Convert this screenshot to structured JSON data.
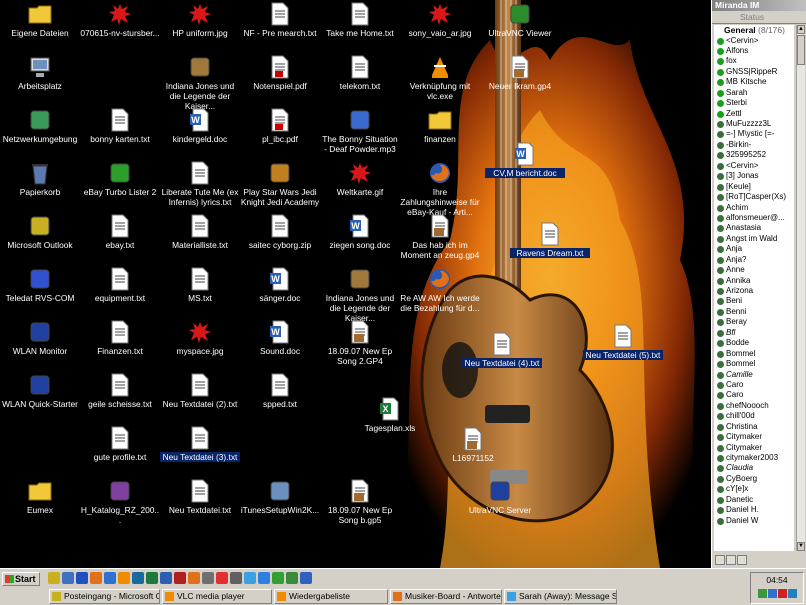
{
  "desktop": {
    "icons": [
      {
        "label": "Eigene Dateien",
        "icon": "folder-icon",
        "color": "#f0c838"
      },
      {
        "label": "070615-nv-stursber...",
        "icon": "red-splat-icon",
        "color": "#d81818"
      },
      {
        "label": "HP uniform.jpg",
        "icon": "red-splat-icon",
        "color": "#d81818"
      },
      {
        "label": "NF - Pre mearch.txt",
        "icon": "text-file-icon",
        "color": "#ffffff"
      },
      {
        "label": "Take me Home.txt",
        "icon": "text-file-icon",
        "color": "#ffffff"
      },
      {
        "label": "sony_vaio_ar.jpg",
        "icon": "red-splat-icon",
        "color": "#d81818"
      },
      {
        "label": "UltraVNC Viewer",
        "icon": "vnc-viewer-icon",
        "color": "#2a8c2a"
      },
      {
        "label": "Arbeitsplatz",
        "icon": "computer-icon",
        "color": "#7090c0"
      },
      {
        "label": "Indiana Jones und die Legende der Kaiser...",
        "icon": "game-icon",
        "color": "#a0783c"
      },
      {
        "label": "Notenspiel.pdf",
        "icon": "pdf-icon",
        "color": "#ffffff"
      },
      {
        "label": "telekom.txt",
        "icon": "text-file-icon",
        "color": "#ffffff"
      },
      {
        "label": "Verknüpfung mit vlc.exe",
        "icon": "vlc-icon",
        "color": "#f08c00"
      },
      {
        "label": "Neuer Ikram.gp4",
        "icon": "media-file-icon",
        "color": "#ffffff"
      },
      {
        "label": "Netzwerkumgebung",
        "icon": "network-icon",
        "color": "#3a9a5a"
      },
      {
        "label": "bonny karten.txt",
        "icon": "text-file-icon",
        "color": "#ffffff"
      },
      {
        "label": "kindergeld.doc",
        "icon": "word-doc-icon",
        "color": "#2b5fb4"
      },
      {
        "label": "pl_ibc.pdf",
        "icon": "pdf-icon",
        "color": "#ffffff"
      },
      {
        "label": "The Bonny Situation - Deaf Powder.mp3",
        "icon": "mp3-icon",
        "color": "#3a6ad0"
      },
      {
        "label": "finanzen",
        "icon": "folder-icon",
        "color": "#f0c838"
      },
      {
        "label": "CV,M bericht.doc",
        "icon": "word-doc-icon",
        "color": "#2b5fb4"
      },
      {
        "label": "Papierkorb",
        "icon": "recycle-bin-icon",
        "color": "#5a7ab0"
      },
      {
        "label": "eBay Turbo Lister 2",
        "icon": "ebay-lister-icon",
        "color": "#2aa02a"
      },
      {
        "label": "Liberate Tute Me (ex Infernis) lyrics.txt",
        "icon": "text-file-icon",
        "color": "#ffffff"
      },
      {
        "label": "Play Star Wars Jedi Knight Jedi Academy",
        "icon": "starwars-icon",
        "color": "#c08020"
      },
      {
        "label": "Weltkarte.gif",
        "icon": "red-splat-icon",
        "color": "#d81818"
      },
      {
        "label": "Ihre Zahlungshinweise für eBay-Kauf - Arti...",
        "icon": "firefox-icon",
        "color": "#e0701a"
      },
      {
        "label": "Ravens Dream.txt",
        "icon": "text-file-icon",
        "color": "#ffffff"
      },
      {
        "label": "Microsoft Outlook",
        "icon": "outlook-icon",
        "color": "#c8b020"
      },
      {
        "label": "ebay.txt",
        "icon": "text-file-icon",
        "color": "#ffffff"
      },
      {
        "label": "Materialliste.txt",
        "icon": "text-file-icon",
        "color": "#ffffff"
      },
      {
        "label": "saitec cyborg.zip",
        "icon": "zip-icon",
        "color": "#ffffff"
      },
      {
        "label": "ziegen song.doc",
        "icon": "word-doc-icon",
        "color": "#2b5fb4"
      },
      {
        "label": "Das hab ich im Moment an zeug.gp4",
        "icon": "media-file-icon",
        "color": "#ffffff"
      },
      {
        "label": "Teledat RVS-COM",
        "icon": "teledat-icon",
        "color": "#3050d0"
      },
      {
        "label": "equipment.txt",
        "icon": "text-file-icon",
        "color": "#ffffff"
      },
      {
        "label": "MS.txt",
        "icon": "text-file-icon",
        "color": "#ffffff"
      },
      {
        "label": "sänger.doc",
        "icon": "word-doc-icon",
        "color": "#2b5fb4"
      },
      {
        "label": "Indiana Jones und die Legende der Kaiser...",
        "icon": "game-icon",
        "color": "#a0783c"
      },
      {
        "label": "Re AW AW Ich werde die Bezahlung für d...",
        "icon": "firefox-icon",
        "color": "#e0701a"
      },
      {
        "label": "WLAN Monitor",
        "icon": "wlan-icon",
        "color": "#2040a0"
      },
      {
        "label": "Finanzen.txt",
        "icon": "text-file-icon",
        "color": "#ffffff"
      },
      {
        "label": "myspace.jpg",
        "icon": "red-splat-icon",
        "color": "#d81818"
      },
      {
        "label": "Sound.doc",
        "icon": "word-doc-icon",
        "color": "#2b5fb4"
      },
      {
        "label": "18.09.07 New Ep Song 2.GP4",
        "icon": "media-file-icon",
        "color": "#ffffff"
      },
      {
        "label": "Neu Textdatei (4).txt",
        "icon": "text-file-icon",
        "color": "#ffffff"
      },
      {
        "label": "Neu Textdatei (5).txt",
        "icon": "text-file-icon",
        "color": "#ffffff"
      },
      {
        "label": "WLAN Quick-Starter",
        "icon": "wlan-icon",
        "color": "#2040a0"
      },
      {
        "label": "geile scheisse.txt",
        "icon": "text-file-icon",
        "color": "#ffffff"
      },
      {
        "label": "Neu Textdatei (2).txt",
        "icon": "text-file-icon",
        "color": "#ffffff"
      },
      {
        "label": "spped.txt",
        "icon": "text-file-icon",
        "color": "#ffffff"
      },
      {
        "label": "Tagesplan.xls",
        "icon": "excel-icon",
        "color": "#1d7a3a"
      },
      {
        "label": "gute profile.txt",
        "icon": "text-file-icon",
        "color": "#ffffff"
      },
      {
        "label": "Neu Textdatei (3).txt",
        "icon": "text-file-icon",
        "color": "#ffffff"
      },
      {
        "label": "L16971152",
        "icon": "media-file-icon",
        "color": "#ffffff"
      },
      {
        "label": "Eumex",
        "icon": "folder-icon",
        "color": "#f0c838"
      },
      {
        "label": "H_Katalog_RZ_200...",
        "icon": "rar-icon",
        "color": "#8040a0"
      },
      {
        "label": "Neu Textdatei.txt",
        "icon": "text-file-icon",
        "color": "#ffffff"
      },
      {
        "label": "iTunesSetupWin2K...",
        "icon": "installer-icon",
        "color": "#6a90c0"
      },
      {
        "label": "18.09.07 New Ep Song b.gp5",
        "icon": "media-file-icon",
        "color": "#ffffff"
      },
      {
        "label": "UltraVNC Server",
        "icon": "vnc-server-icon",
        "color": "#2040a0"
      }
    ]
  },
  "miranda": {
    "title": "Miranda IM",
    "status": "Status",
    "group": {
      "name": "General",
      "count": "(8/176)"
    },
    "contacts": [
      {
        "name": "<Cervin>",
        "state": "online"
      },
      {
        "name": "Alfons",
        "state": "online"
      },
      {
        "name": "fox",
        "state": "online"
      },
      {
        "name": "GNSS|RippeR",
        "state": "online"
      },
      {
        "name": "MB Kitsche",
        "state": "online"
      },
      {
        "name": "Sarah",
        "state": "online"
      },
      {
        "name": "Sterbi",
        "state": "online"
      },
      {
        "name": "Zettl",
        "state": "online"
      },
      {
        "name": "MuFuzzzz3L",
        "state": "offline"
      },
      {
        "name": "=-] M\\ystic [=-",
        "state": "offline"
      },
      {
        "name": "-Birkin-",
        "state": "offline"
      },
      {
        "name": "325995252",
        "state": "offline"
      },
      {
        "name": "<Cervin>",
        "state": "offline"
      },
      {
        "name": "[3] Jonas",
        "state": "offline"
      },
      {
        "name": "[Keule]",
        "state": "offline"
      },
      {
        "name": "[RoT]Casper(Xs)",
        "state": "offline"
      },
      {
        "name": "Achim",
        "state": "offline"
      },
      {
        "name": "alfonsmeuer@...",
        "state": "offline"
      },
      {
        "name": "Anastasia",
        "state": "offline"
      },
      {
        "name": "Angst im Wald",
        "state": "offline"
      },
      {
        "name": "Anja",
        "state": "offline"
      },
      {
        "name": "Anja?",
        "state": "offline"
      },
      {
        "name": "Anne",
        "state": "offline"
      },
      {
        "name": "Annika",
        "state": "offline"
      },
      {
        "name": "Arizona",
        "state": "offline"
      },
      {
        "name": "Beni",
        "state": "offline"
      },
      {
        "name": "Benni",
        "state": "offline"
      },
      {
        "name": "Beray",
        "state": "offline"
      },
      {
        "name": "Bfl",
        "state": "offline",
        "italic": true
      },
      {
        "name": "Bodde",
        "state": "offline"
      },
      {
        "name": "Bommel",
        "state": "offline"
      },
      {
        "name": "Bommel",
        "state": "offline"
      },
      {
        "name": "Camille",
        "state": "offline",
        "italic": true
      },
      {
        "name": "Caro",
        "state": "offline"
      },
      {
        "name": "Caro",
        "state": "offline"
      },
      {
        "name": "chefNoooch",
        "state": "offline"
      },
      {
        "name": "chill'00d",
        "state": "offline"
      },
      {
        "name": "Christina",
        "state": "offline"
      },
      {
        "name": "Citymaker",
        "state": "offline"
      },
      {
        "name": "Citymaker",
        "state": "offline"
      },
      {
        "name": "citymaker2003",
        "state": "offline"
      },
      {
        "name": "Claudia",
        "state": "offline",
        "italic": true
      },
      {
        "name": "CyBoerg",
        "state": "offline"
      },
      {
        "name": "cY[e]x",
        "state": "offline"
      },
      {
        "name": "Danetic",
        "state": "offline"
      },
      {
        "name": "Daniel H.",
        "state": "offline"
      },
      {
        "name": "Daniel W",
        "state": "offline"
      }
    ],
    "state_colors": {
      "online": "#19a019",
      "offline": "#3c6e3c"
    }
  },
  "taskbar": {
    "start_label": "Start",
    "quicklaunch": [
      {
        "icon": "outlook-ql-icon",
        "color": "#c8b020"
      },
      {
        "icon": "desktop-ql-icon",
        "color": "#4070c0"
      },
      {
        "icon": "ie-ql-icon",
        "color": "#2050c0"
      },
      {
        "icon": "firefox-ql-icon",
        "color": "#e0701a"
      },
      {
        "icon": "thunderbird-ql-icon",
        "color": "#3070d0"
      },
      {
        "icon": "vlc-ql-icon",
        "color": "#f08c00"
      },
      {
        "icon": "app-ql-icon",
        "color": "#1a6aa0"
      },
      {
        "icon": "excel-ql-icon",
        "color": "#1d7a3a"
      },
      {
        "icon": "word-ql-icon",
        "color": "#2b5fb4"
      },
      {
        "icon": "media-ql-icon",
        "color": "#b02020"
      },
      {
        "icon": "firefox-ql-icon-2",
        "color": "#e0701a"
      },
      {
        "icon": "winamp-ql-icon",
        "color": "#707070"
      },
      {
        "icon": "ql-icon-13",
        "color": "#e03030"
      },
      {
        "icon": "ql-icon-14",
        "color": "#606060"
      },
      {
        "icon": "skype-ql-icon",
        "color": "#3aa0e0"
      },
      {
        "icon": "ql-icon-16",
        "color": "#3080e0"
      },
      {
        "icon": "ql-icon-17",
        "color": "#30a030"
      },
      {
        "icon": "ql-icon-18",
        "color": "#3a8a3a"
      },
      {
        "icon": "ql-icon-19",
        "color": "#3060c0"
      }
    ],
    "tasks": [
      {
        "label": "Posteingang - Microsoft O...",
        "color": "#c8b020"
      },
      {
        "label": "VLC media player",
        "color": "#f08c00"
      },
      {
        "label": "Wiedergabeliste",
        "color": "#f08c00"
      },
      {
        "label": "Musiker-Board - Antworte...",
        "color": "#e0701a"
      },
      {
        "label": "Sarah (Away): Message S...",
        "color": "#3aa0e0"
      }
    ],
    "clock": "04:54"
  }
}
